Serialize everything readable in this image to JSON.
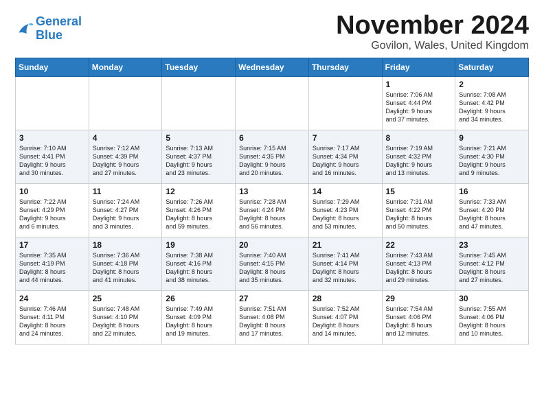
{
  "logo": {
    "line1": "General",
    "line2": "Blue"
  },
  "title": "November 2024",
  "location": "Govilon, Wales, United Kingdom",
  "days_of_week": [
    "Sunday",
    "Monday",
    "Tuesday",
    "Wednesday",
    "Thursday",
    "Friday",
    "Saturday"
  ],
  "weeks": [
    [
      {
        "day": "",
        "info": ""
      },
      {
        "day": "",
        "info": ""
      },
      {
        "day": "",
        "info": ""
      },
      {
        "day": "",
        "info": ""
      },
      {
        "day": "",
        "info": ""
      },
      {
        "day": "1",
        "info": "Sunrise: 7:06 AM\nSunset: 4:44 PM\nDaylight: 9 hours\nand 37 minutes."
      },
      {
        "day": "2",
        "info": "Sunrise: 7:08 AM\nSunset: 4:42 PM\nDaylight: 9 hours\nand 34 minutes."
      }
    ],
    [
      {
        "day": "3",
        "info": "Sunrise: 7:10 AM\nSunset: 4:41 PM\nDaylight: 9 hours\nand 30 minutes."
      },
      {
        "day": "4",
        "info": "Sunrise: 7:12 AM\nSunset: 4:39 PM\nDaylight: 9 hours\nand 27 minutes."
      },
      {
        "day": "5",
        "info": "Sunrise: 7:13 AM\nSunset: 4:37 PM\nDaylight: 9 hours\nand 23 minutes."
      },
      {
        "day": "6",
        "info": "Sunrise: 7:15 AM\nSunset: 4:35 PM\nDaylight: 9 hours\nand 20 minutes."
      },
      {
        "day": "7",
        "info": "Sunrise: 7:17 AM\nSunset: 4:34 PM\nDaylight: 9 hours\nand 16 minutes."
      },
      {
        "day": "8",
        "info": "Sunrise: 7:19 AM\nSunset: 4:32 PM\nDaylight: 9 hours\nand 13 minutes."
      },
      {
        "day": "9",
        "info": "Sunrise: 7:21 AM\nSunset: 4:30 PM\nDaylight: 9 hours\nand 9 minutes."
      }
    ],
    [
      {
        "day": "10",
        "info": "Sunrise: 7:22 AM\nSunset: 4:29 PM\nDaylight: 9 hours\nand 6 minutes."
      },
      {
        "day": "11",
        "info": "Sunrise: 7:24 AM\nSunset: 4:27 PM\nDaylight: 9 hours\nand 3 minutes."
      },
      {
        "day": "12",
        "info": "Sunrise: 7:26 AM\nSunset: 4:26 PM\nDaylight: 8 hours\nand 59 minutes."
      },
      {
        "day": "13",
        "info": "Sunrise: 7:28 AM\nSunset: 4:24 PM\nDaylight: 8 hours\nand 56 minutes."
      },
      {
        "day": "14",
        "info": "Sunrise: 7:29 AM\nSunset: 4:23 PM\nDaylight: 8 hours\nand 53 minutes."
      },
      {
        "day": "15",
        "info": "Sunrise: 7:31 AM\nSunset: 4:22 PM\nDaylight: 8 hours\nand 50 minutes."
      },
      {
        "day": "16",
        "info": "Sunrise: 7:33 AM\nSunset: 4:20 PM\nDaylight: 8 hours\nand 47 minutes."
      }
    ],
    [
      {
        "day": "17",
        "info": "Sunrise: 7:35 AM\nSunset: 4:19 PM\nDaylight: 8 hours\nand 44 minutes."
      },
      {
        "day": "18",
        "info": "Sunrise: 7:36 AM\nSunset: 4:18 PM\nDaylight: 8 hours\nand 41 minutes."
      },
      {
        "day": "19",
        "info": "Sunrise: 7:38 AM\nSunset: 4:16 PM\nDaylight: 8 hours\nand 38 minutes."
      },
      {
        "day": "20",
        "info": "Sunrise: 7:40 AM\nSunset: 4:15 PM\nDaylight: 8 hours\nand 35 minutes."
      },
      {
        "day": "21",
        "info": "Sunrise: 7:41 AM\nSunset: 4:14 PM\nDaylight: 8 hours\nand 32 minutes."
      },
      {
        "day": "22",
        "info": "Sunrise: 7:43 AM\nSunset: 4:13 PM\nDaylight: 8 hours\nand 29 minutes."
      },
      {
        "day": "23",
        "info": "Sunrise: 7:45 AM\nSunset: 4:12 PM\nDaylight: 8 hours\nand 27 minutes."
      }
    ],
    [
      {
        "day": "24",
        "info": "Sunrise: 7:46 AM\nSunset: 4:11 PM\nDaylight: 8 hours\nand 24 minutes."
      },
      {
        "day": "25",
        "info": "Sunrise: 7:48 AM\nSunset: 4:10 PM\nDaylight: 8 hours\nand 22 minutes."
      },
      {
        "day": "26",
        "info": "Sunrise: 7:49 AM\nSunset: 4:09 PM\nDaylight: 8 hours\nand 19 minutes."
      },
      {
        "day": "27",
        "info": "Sunrise: 7:51 AM\nSunset: 4:08 PM\nDaylight: 8 hours\nand 17 minutes."
      },
      {
        "day": "28",
        "info": "Sunrise: 7:52 AM\nSunset: 4:07 PM\nDaylight: 8 hours\nand 14 minutes."
      },
      {
        "day": "29",
        "info": "Sunrise: 7:54 AM\nSunset: 4:06 PM\nDaylight: 8 hours\nand 12 minutes."
      },
      {
        "day": "30",
        "info": "Sunrise: 7:55 AM\nSunset: 4:06 PM\nDaylight: 8 hours\nand 10 minutes."
      }
    ]
  ]
}
